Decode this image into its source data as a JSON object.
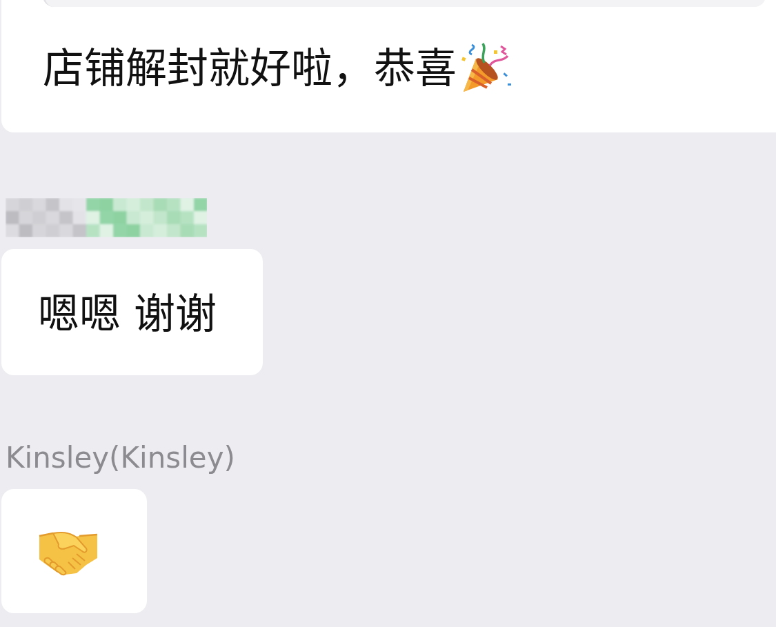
{
  "messages": [
    {
      "kind": "text",
      "quoted": true,
      "text": "店铺解封就好啦，恭喜",
      "party_emoji": true
    },
    {
      "kind": "text",
      "sender_hidden": true,
      "text": "嗯嗯 谢谢"
    },
    {
      "kind": "emoji",
      "sender": "Kinsley(Kinsley)"
    }
  ]
}
